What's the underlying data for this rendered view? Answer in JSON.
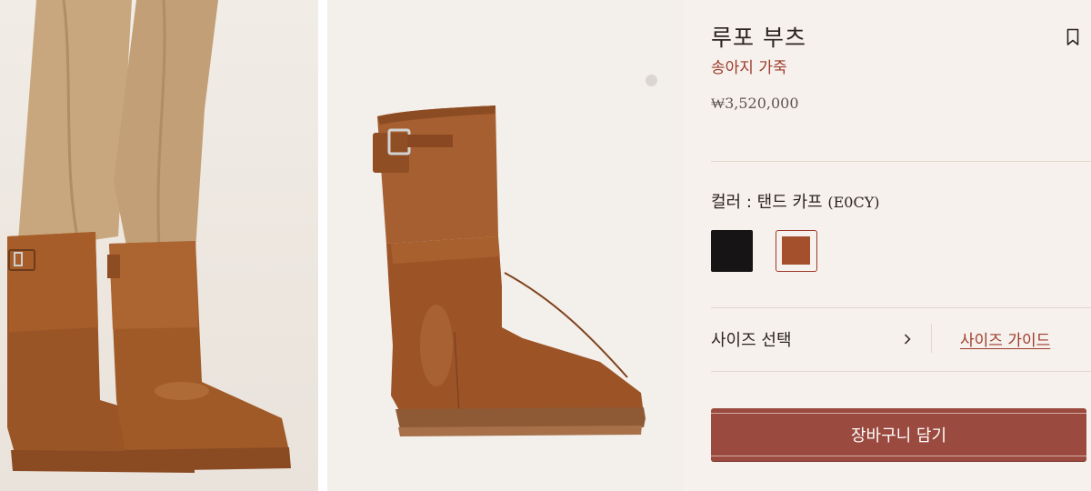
{
  "product": {
    "title": "루포 부츠",
    "material": "송아지 가죽",
    "price": "₩3,520,000"
  },
  "color": {
    "label_prefix": "컬러 : ",
    "selected_name": "탠드 카프",
    "selected_code": "(E0CY)",
    "swatches": [
      {
        "name": "black",
        "hex": "#161414"
      },
      {
        "name": "tan",
        "hex": "#a4502d",
        "selected": true
      }
    ]
  },
  "size": {
    "select_label": "사이즈 선택",
    "guide_label": "사이즈 가이드"
  },
  "cart": {
    "button_label": "장바구니 담기"
  },
  "gallery": {
    "images": [
      "model-wearing-boots",
      "single-boot-product"
    ],
    "active_index": 1
  },
  "icons": {
    "bookmark": "bookmark-icon",
    "chevron": "chevron-right-icon"
  },
  "colors": {
    "accent": "#9d3b2c",
    "cart_button": "#9b4a3f",
    "leather": "#a4502d",
    "background": "#f6f1ec"
  }
}
